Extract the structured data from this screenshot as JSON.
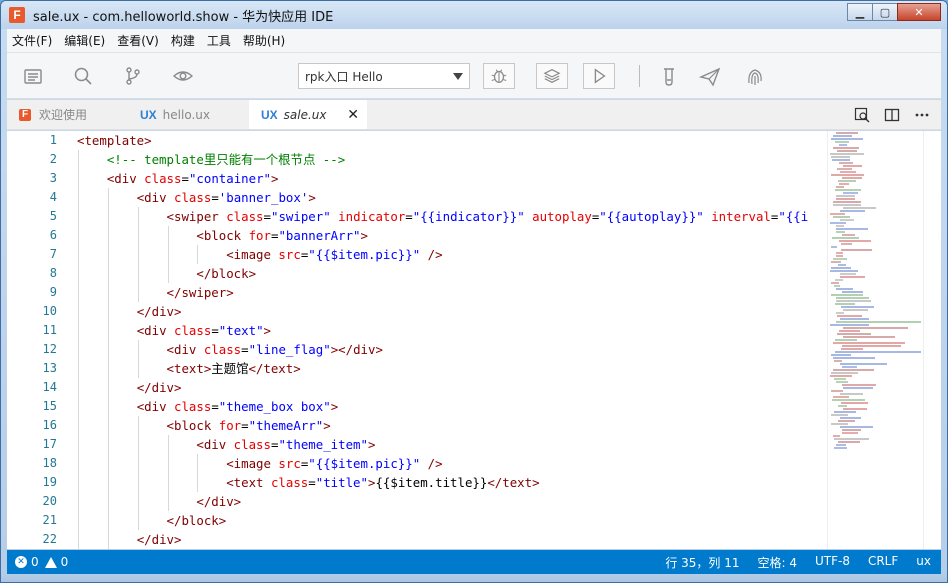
{
  "window": {
    "title": "sale.ux - com.helloworld.show - 华为快应用 IDE",
    "logo_letter": "F",
    "controls": {
      "minimize": "▁",
      "maximize": "▢",
      "close": "✕"
    }
  },
  "menu": [
    "文件(F)",
    "编辑(E)",
    "查看(V)",
    "构建",
    "工具",
    "帮助(H)"
  ],
  "toolbar": {
    "icons": [
      "explorer-icon",
      "search-icon",
      "source-control-icon",
      "preview-icon"
    ],
    "entry_select": "rpk入口 Hello",
    "buttons": [
      "debug-icon",
      "layers-icon",
      "run-icon"
    ],
    "tools": [
      "test-tube-icon",
      "send-icon",
      "fingerprint-icon"
    ]
  },
  "tabs": [
    {
      "tag": "F",
      "label": "欢迎使用",
      "active": false
    },
    {
      "tag": "UX",
      "label": "hello.ux",
      "active": false
    },
    {
      "tag": "UX",
      "label": "sale.ux",
      "active": true,
      "close": "✕"
    }
  ],
  "editor": {
    "line_numbers": [
      "1",
      "2",
      "3",
      "4",
      "5",
      "6",
      "7",
      "8",
      "9",
      "10",
      "11",
      "12",
      "13",
      "14",
      "15",
      "16",
      "17",
      "18",
      "19",
      "20",
      "21",
      "22"
    ],
    "lines": [
      {
        "indent": 0,
        "tokens": [
          [
            "tag",
            "<template>"
          ]
        ]
      },
      {
        "indent": 1,
        "tokens": [
          [
            "cmt",
            "<!-- template里只能有一个根节点 -->"
          ]
        ]
      },
      {
        "indent": 1,
        "tokens": [
          [
            "tag",
            "<div "
          ],
          [
            "attr",
            "class"
          ],
          [
            "txt",
            "="
          ],
          [
            "str",
            "\"container\""
          ],
          [
            "tag",
            ">"
          ]
        ]
      },
      {
        "indent": 2,
        "tokens": [
          [
            "tag",
            "<div "
          ],
          [
            "attr",
            "class"
          ],
          [
            "txt",
            "="
          ],
          [
            "str",
            "'banner_box'"
          ],
          [
            "tag",
            ">"
          ]
        ]
      },
      {
        "indent": 3,
        "tokens": [
          [
            "tag",
            "<swiper "
          ],
          [
            "attr",
            "class"
          ],
          [
            "txt",
            "="
          ],
          [
            "str",
            "\"swiper\""
          ],
          [
            "txt",
            " "
          ],
          [
            "attr",
            "indicator"
          ],
          [
            "txt",
            "="
          ],
          [
            "str",
            "\"{{indicator}}\""
          ],
          [
            "txt",
            " "
          ],
          [
            "attr",
            "autoplay"
          ],
          [
            "txt",
            "="
          ],
          [
            "str",
            "\"{{autoplay}}\""
          ],
          [
            "txt",
            " "
          ],
          [
            "attr",
            "interval"
          ],
          [
            "txt",
            "="
          ],
          [
            "str",
            "\"{{i"
          ]
        ]
      },
      {
        "indent": 4,
        "tokens": [
          [
            "tag",
            "<block "
          ],
          [
            "attr",
            "for"
          ],
          [
            "txt",
            "="
          ],
          [
            "str",
            "\"bannerArr\""
          ],
          [
            "tag",
            ">"
          ]
        ]
      },
      {
        "indent": 5,
        "tokens": [
          [
            "tag",
            "<image "
          ],
          [
            "attr",
            "src"
          ],
          [
            "txt",
            "="
          ],
          [
            "str",
            "\"{{$item.pic}}\""
          ],
          [
            "tag",
            " />"
          ]
        ]
      },
      {
        "indent": 4,
        "tokens": [
          [
            "tag",
            "</block>"
          ]
        ]
      },
      {
        "indent": 3,
        "tokens": [
          [
            "tag",
            "</swiper>"
          ]
        ]
      },
      {
        "indent": 2,
        "tokens": [
          [
            "tag",
            "</div>"
          ]
        ]
      },
      {
        "indent": 2,
        "tokens": [
          [
            "tag",
            "<div "
          ],
          [
            "attr",
            "class"
          ],
          [
            "txt",
            "="
          ],
          [
            "str",
            "\"text\""
          ],
          [
            "tag",
            ">"
          ]
        ]
      },
      {
        "indent": 3,
        "tokens": [
          [
            "tag",
            "<div "
          ],
          [
            "attr",
            "class"
          ],
          [
            "txt",
            "="
          ],
          [
            "str",
            "\"line_flag\""
          ],
          [
            "tag",
            "></div>"
          ]
        ]
      },
      {
        "indent": 3,
        "tokens": [
          [
            "tag",
            "<text>"
          ],
          [
            "txt",
            "主题馆"
          ],
          [
            "tag",
            "</text>"
          ]
        ]
      },
      {
        "indent": 2,
        "tokens": [
          [
            "tag",
            "</div>"
          ]
        ]
      },
      {
        "indent": 2,
        "tokens": [
          [
            "tag",
            "<div "
          ],
          [
            "attr",
            "class"
          ],
          [
            "txt",
            "="
          ],
          [
            "str",
            "\"theme_box box\""
          ],
          [
            "tag",
            ">"
          ]
        ]
      },
      {
        "indent": 3,
        "tokens": [
          [
            "tag",
            "<block "
          ],
          [
            "attr",
            "for"
          ],
          [
            "txt",
            "="
          ],
          [
            "str",
            "\"themeArr\""
          ],
          [
            "tag",
            ">"
          ]
        ]
      },
      {
        "indent": 4,
        "tokens": [
          [
            "tag",
            "<div "
          ],
          [
            "attr",
            "class"
          ],
          [
            "txt",
            "="
          ],
          [
            "str",
            "\"theme_item\""
          ],
          [
            "tag",
            ">"
          ]
        ]
      },
      {
        "indent": 5,
        "tokens": [
          [
            "tag",
            "<image "
          ],
          [
            "attr",
            "src"
          ],
          [
            "txt",
            "="
          ],
          [
            "str",
            "\"{{$item.pic}}\""
          ],
          [
            "tag",
            " />"
          ]
        ]
      },
      {
        "indent": 5,
        "tokens": [
          [
            "tag",
            "<text "
          ],
          [
            "attr",
            "class"
          ],
          [
            "txt",
            "="
          ],
          [
            "str",
            "\"title\""
          ],
          [
            "tag",
            ">"
          ],
          [
            "txt",
            "{{$item.title}}"
          ],
          [
            "tag",
            "</text>"
          ]
        ]
      },
      {
        "indent": 4,
        "tokens": [
          [
            "tag",
            "</div>"
          ]
        ]
      },
      {
        "indent": 3,
        "tokens": [
          [
            "tag",
            "</block>"
          ]
        ]
      },
      {
        "indent": 2,
        "tokens": [
          [
            "tag",
            "</div>"
          ]
        ]
      }
    ]
  },
  "status": {
    "errors": "0",
    "warnings": "0",
    "position": "行 35，列 11",
    "spaces": "空格: 4",
    "encoding": "UTF-8",
    "eol": "CRLF",
    "language": "ux"
  },
  "colors": {
    "status_bar": "#007acc",
    "tag": "#800000",
    "attr": "#e50000",
    "string": "#0000ff",
    "comment": "#008000",
    "line_number": "#237893"
  }
}
